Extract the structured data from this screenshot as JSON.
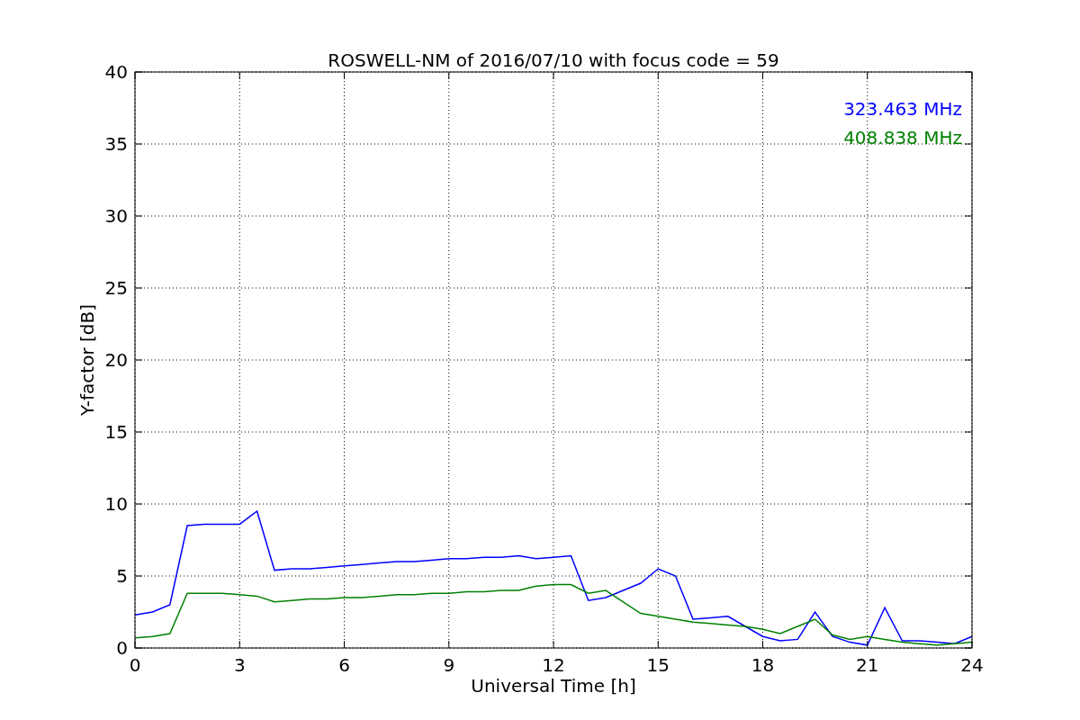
{
  "chart_data": {
    "type": "line",
    "title": "ROSWELL-NM of 2016/07/10 with focus code = 59",
    "xlabel": "Universal Time [h]",
    "ylabel": "Y-factor [dB]",
    "xlim": [
      0,
      24
    ],
    "ylim": [
      0,
      40
    ],
    "xticks": [
      0,
      3,
      6,
      9,
      12,
      15,
      18,
      21,
      24
    ],
    "yticks": [
      0,
      5,
      10,
      15,
      20,
      25,
      30,
      35,
      40
    ],
    "grid": true,
    "x": [
      0,
      0.5,
      1,
      1.5,
      2,
      2.5,
      3,
      3.5,
      4,
      4.5,
      5,
      5.5,
      6,
      6.5,
      7,
      7.5,
      8,
      8.5,
      9,
      9.5,
      10,
      10.5,
      11,
      11.5,
      12,
      12.5,
      13,
      13.5,
      14,
      14.5,
      15,
      15.5,
      16,
      16.5,
      17,
      17.5,
      18,
      18.5,
      19,
      19.5,
      20,
      20.5,
      21,
      21.5,
      22,
      22.5,
      23,
      23.5,
      24
    ],
    "series": [
      {
        "name": "323.463 MHz",
        "color": "#0000ff",
        "values": [
          2.3,
          2.5,
          3.0,
          8.5,
          8.6,
          8.6,
          8.6,
          9.5,
          5.4,
          5.5,
          5.5,
          5.6,
          5.7,
          5.8,
          5.9,
          6.0,
          6.0,
          6.1,
          6.2,
          6.2,
          6.3,
          6.3,
          6.4,
          6.2,
          6.3,
          6.4,
          3.3,
          3.5,
          4.0,
          4.5,
          5.5,
          5.0,
          2.0,
          2.1,
          2.2,
          1.5,
          0.8,
          0.5,
          0.6,
          2.5,
          0.8,
          0.4,
          0.2,
          2.8,
          0.5,
          0.5,
          0.4,
          0.3,
          0.8
        ]
      },
      {
        "name": "408.838 MHz",
        "color": "#008000",
        "values": [
          0.7,
          0.8,
          1.0,
          3.8,
          3.8,
          3.8,
          3.7,
          3.6,
          3.2,
          3.3,
          3.4,
          3.4,
          3.5,
          3.5,
          3.6,
          3.7,
          3.7,
          3.8,
          3.8,
          3.9,
          3.9,
          4.0,
          4.0,
          4.3,
          4.4,
          4.4,
          3.8,
          4.0,
          3.2,
          2.4,
          2.2,
          2.0,
          1.8,
          1.7,
          1.6,
          1.5,
          1.3,
          1.0,
          1.5,
          2.0,
          0.9,
          0.6,
          0.8,
          0.6,
          0.4,
          0.3,
          0.2,
          0.3,
          0.4
        ]
      }
    ]
  }
}
